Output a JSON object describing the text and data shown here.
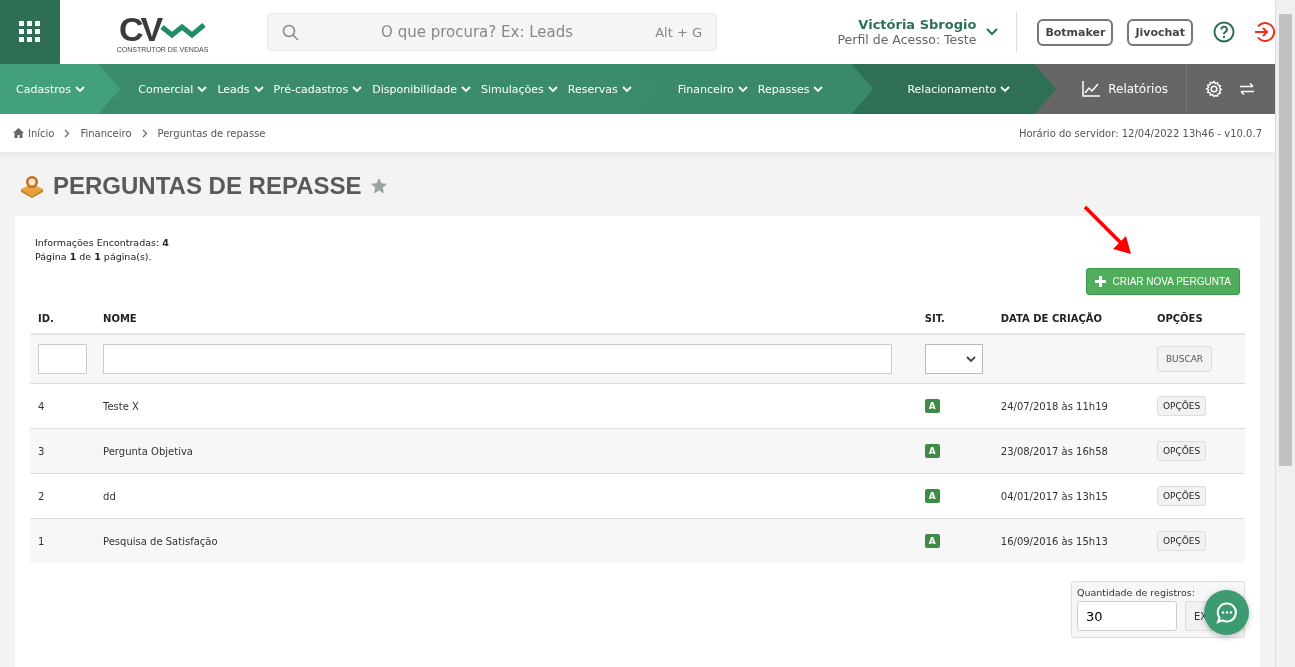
{
  "header": {
    "logo": {
      "text": "CV",
      "tagline": "CONSTRUTOR DE VENDAS"
    },
    "search": {
      "placeholder": "O que procura? Ex: Leads",
      "shortcut": "Alt + G"
    },
    "user": {
      "name": "Victória Sbrogio",
      "profile": "Perfil de Acesso: Teste"
    },
    "buttons": [
      "Botmaker",
      "Jivochat"
    ]
  },
  "nav": {
    "groups": [
      {
        "items": [
          "Cadastros"
        ]
      },
      {
        "items": [
          "Comercial",
          "Leads",
          "Pré-cadastros",
          "Disponibilidade",
          "Simulações",
          "Reservas"
        ]
      },
      {
        "items": [
          "Financeiro",
          "Repasses"
        ]
      },
      {
        "items": [
          "Relacionamento"
        ]
      }
    ],
    "reports": "Relatórios"
  },
  "breadcrumb": {
    "items": [
      "Início",
      "Financeiro",
      "Perguntas de repasse"
    ],
    "server_time": "Horário do servidor: 12/04/2022 13h46 - v10.0.7"
  },
  "page_title": "PERGUNTAS DE REPASSE",
  "summary": [
    "Informações Encontradas: **4**",
    "Página **1** de **1** página(s)."
  ],
  "create_button": "CRIAR NOVA PERGUNTA",
  "table": {
    "columns": [
      "ID.",
      "NOME",
      "SIT.",
      "DATA DE CRIAÇÃO",
      "OPÇÕES"
    ],
    "filter_button": "BUSCAR",
    "rows": [
      {
        "id": "4",
        "name": "Teste X",
        "status": "A",
        "date": "24/07/2018 às 11h19",
        "options": "OPÇÕES"
      },
      {
        "id": "3",
        "name": "Pergunta Objetiva",
        "status": "A",
        "date": "23/08/2017 às 16h58",
        "options": "OPÇÕES"
      },
      {
        "id": "2",
        "name": "dd",
        "status": "A",
        "date": "04/01/2017 às 13h15",
        "options": "OPÇÕES"
      },
      {
        "id": "1",
        "name": "Pesquisa de Satisfação",
        "status": "A",
        "date": "16/09/2016 às 15h13",
        "options": "OPÇÕES"
      }
    ]
  },
  "records": {
    "label": "Quantidade de registros:",
    "value": "30",
    "button": "EX"
  }
}
